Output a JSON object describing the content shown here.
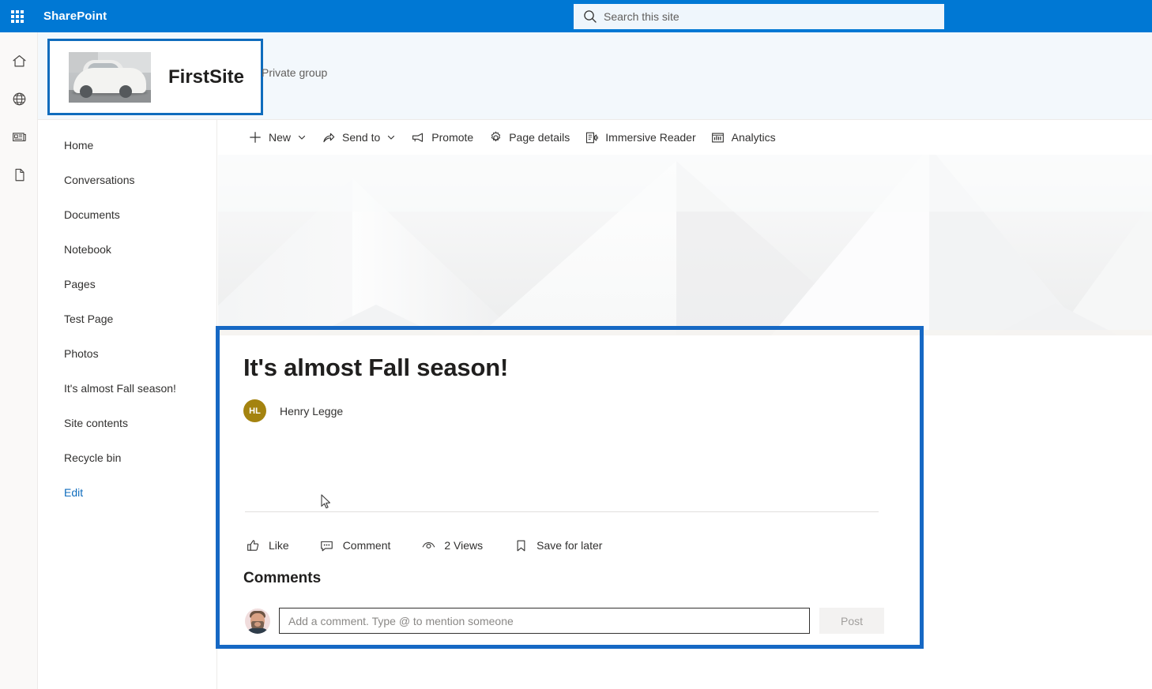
{
  "suite": {
    "brand": "SharePoint",
    "waffle_icon": "app-launcher-waffle-icon",
    "search": {
      "icon": "search-icon",
      "placeholder": "Search this site",
      "value": ""
    },
    "brand_color": "#0078d4"
  },
  "app_rail": {
    "items": [
      {
        "icon": "home-icon",
        "label": "Home"
      },
      {
        "icon": "globe-icon",
        "label": "My sites"
      },
      {
        "icon": "news-feed-icon",
        "label": "News"
      },
      {
        "icon": "document-icon",
        "label": "Files"
      }
    ]
  },
  "site_header": {
    "logo_icon": "site-logo-car-image",
    "title": "FirstSite",
    "privacy": "Private group",
    "highlight_color": "#0f6cbd"
  },
  "left_nav": {
    "items": [
      {
        "label": "Home"
      },
      {
        "label": "Conversations"
      },
      {
        "label": "Documents"
      },
      {
        "label": "Notebook"
      },
      {
        "label": "Pages"
      },
      {
        "label": "Test Page"
      },
      {
        "label": "Photos"
      },
      {
        "label": "It's almost Fall season!"
      },
      {
        "label": "Site contents"
      },
      {
        "label": "Recycle bin"
      }
    ],
    "edit_label": "Edit"
  },
  "command_bar": {
    "items": [
      {
        "label": "New",
        "icon": "plus-icon",
        "chevron": true
      },
      {
        "label": "Send to",
        "icon": "send-to-icon",
        "chevron": true
      },
      {
        "label": "Promote",
        "icon": "promote-icon",
        "chevron": false
      },
      {
        "label": "Page details",
        "icon": "gear-icon",
        "chevron": false
      },
      {
        "label": "Immersive Reader",
        "icon": "immersive-reader-icon",
        "chevron": false
      },
      {
        "label": "Analytics",
        "icon": "analytics-icon",
        "chevron": false
      }
    ]
  },
  "banner": {
    "description": "abstract light gray geometric chevron pattern"
  },
  "page": {
    "title": "It's almost Fall season!",
    "author": {
      "initials": "HL",
      "name": "Henry Legge",
      "avatar_color": "#a4830f"
    },
    "highlight_color": "#1668c4"
  },
  "social_bar": {
    "items": [
      {
        "label": "Like",
        "icon": "thumbs-up-icon"
      },
      {
        "label": "Comment",
        "icon": "comment-bubble-icon"
      },
      {
        "label": "2 Views",
        "icon": "eye-icon"
      },
      {
        "label": "Save for later",
        "icon": "bookmark-icon"
      }
    ]
  },
  "comments": {
    "heading": "Comments",
    "avatar_icon": "commenter-avatar-photo",
    "input": {
      "placeholder": "Add a comment. Type @ to mention someone",
      "value": ""
    },
    "post_label": "Post"
  }
}
